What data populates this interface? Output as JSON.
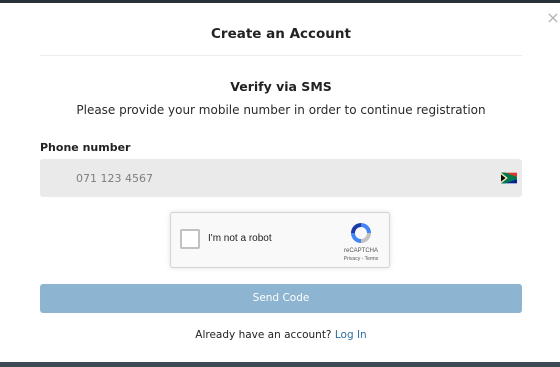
{
  "modal": {
    "title": "Create an Account",
    "close_label": "×"
  },
  "verify": {
    "heading": "Verify via SMS",
    "subtext": "Please provide your mobile number in order to continue registration"
  },
  "phone": {
    "label": "Phone number",
    "placeholder": "071 123 4567",
    "value": "",
    "country_flag_icon": "south-africa-flag-icon"
  },
  "recaptcha": {
    "checkbox_label": "I'm not a robot",
    "brand": "reCAPTCHA",
    "privacy": "Privacy",
    "separator": " - ",
    "terms": "Terms",
    "checked": false
  },
  "actions": {
    "send_code": "Send Code"
  },
  "login": {
    "prompt": "Already have an account?",
    "link": "Log In"
  },
  "colors": {
    "accent": "#8db4d0",
    "link": "#2d6ea3",
    "field_bg": "#eaeaea"
  }
}
